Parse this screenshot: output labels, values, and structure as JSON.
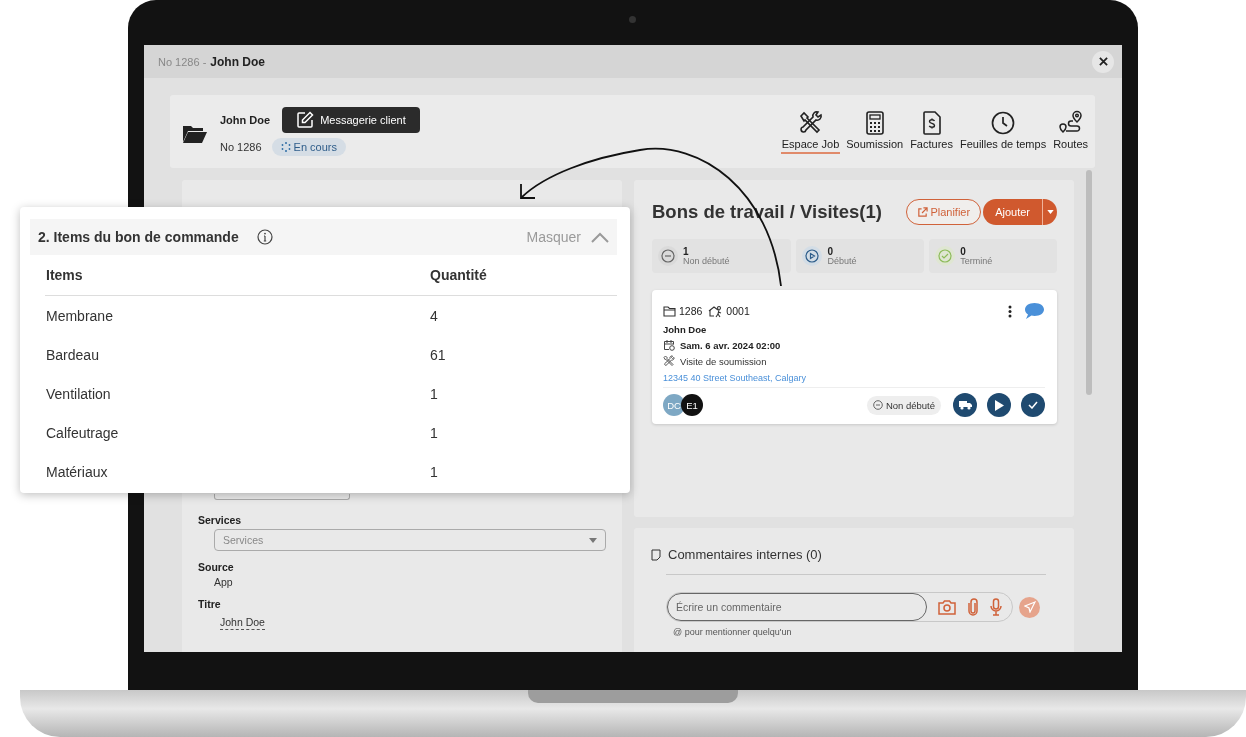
{
  "window": {
    "number": "No 1286 -",
    "title": "John Doe"
  },
  "job": {
    "client": "John Doe",
    "message_button": "Messagerie client",
    "number": "No 1286",
    "status": "En cours"
  },
  "nav": [
    {
      "label": "Espace Job",
      "kind": "tools",
      "selected": true
    },
    {
      "label": "Soumission",
      "kind": "calculator",
      "selected": false
    },
    {
      "label": "Factures",
      "kind": "invoice",
      "selected": false
    },
    {
      "label": "Feuilles de temps",
      "kind": "clock",
      "selected": false
    },
    {
      "label": "Routes",
      "kind": "route",
      "selected": false
    }
  ],
  "client_form": {
    "fields": [
      {
        "label": "Services",
        "kind": "select",
        "placeholder": "Services"
      },
      {
        "label": "Source",
        "kind": "text",
        "value": "App"
      },
      {
        "label": "Titre",
        "kind": "editable",
        "value": "John Doe"
      }
    ]
  },
  "visits": {
    "title": "Bons de travail / Visites(1)",
    "plan_button": "Planifier",
    "add_button": "Ajouter",
    "stats": [
      {
        "count": "1",
        "label": "Non débuté",
        "kind": "not_started"
      },
      {
        "count": "0",
        "label": "Débuté",
        "kind": "started"
      },
      {
        "count": "0",
        "label": "Terminé",
        "kind": "done"
      }
    ],
    "card": {
      "job_number": "1286",
      "visit_number": "0001",
      "client": "John Doe",
      "date": "Sam. 6 avr. 2024 02:00",
      "type": "Visite de soumission",
      "address": "12345 40 Street Southeast, Calgary",
      "assignees": [
        {
          "initials": "DC",
          "color": "#7ea8c4"
        },
        {
          "initials": "E1",
          "color": "#111111"
        }
      ],
      "status": "Non débuté"
    }
  },
  "comments": {
    "title": "Commentaires internes (0)",
    "placeholder": "Écrire un commentaire",
    "hint": "@ pour mentionner quelqu'un"
  },
  "order_items": {
    "title": "2. Items du bon de commande",
    "hide_label": "Masquer",
    "expanded": true,
    "columns": [
      "Items",
      "Quantité"
    ],
    "rows": [
      [
        "Membrane",
        "4"
      ],
      [
        "Bardeau",
        "61"
      ],
      [
        "Ventilation",
        "1"
      ],
      [
        "Calfeutrage",
        "1"
      ],
      [
        "Matériaux",
        "1"
      ]
    ]
  }
}
